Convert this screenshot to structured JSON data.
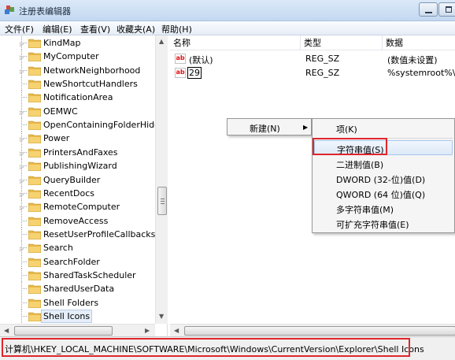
{
  "window": {
    "title": "注册表编辑器"
  },
  "menu": [
    "文件(F)",
    "编辑(E)",
    "查看(V)",
    "收藏夹(A)",
    "帮助(H)"
  ],
  "tree": {
    "items": [
      {
        "label": "KindMap",
        "expandable": true
      },
      {
        "label": "MyComputer",
        "expandable": true
      },
      {
        "label": "NetworkNeighborhood",
        "expandable": true
      },
      {
        "label": "NewShortcutHandlers",
        "expandable": false
      },
      {
        "label": "NotificationArea",
        "expandable": false
      },
      {
        "label": "OEMWC",
        "expandable": true
      },
      {
        "label": "OpenContainingFolderHidde",
        "expandable": false
      },
      {
        "label": "Power",
        "expandable": true
      },
      {
        "label": "PrintersAndFaxes",
        "expandable": true
      },
      {
        "label": "PublishingWizard",
        "expandable": true
      },
      {
        "label": "QueryBuilder",
        "expandable": true
      },
      {
        "label": "RecentDocs",
        "expandable": true
      },
      {
        "label": "RemoteComputer",
        "expandable": true
      },
      {
        "label": "RemoveAccess",
        "expandable": false
      },
      {
        "label": "ResetUserProfileCallbacks",
        "expandable": false
      },
      {
        "label": "Search",
        "expandable": true
      },
      {
        "label": "SearchFolder",
        "expandable": false
      },
      {
        "label": "SharedTaskScheduler",
        "expandable": false
      },
      {
        "label": "SharedUserData",
        "expandable": false
      },
      {
        "label": "Shell Folders",
        "expandable": false
      },
      {
        "label": "Shell Icons",
        "expandable": false,
        "selected": true
      }
    ]
  },
  "list": {
    "columns": [
      "名称",
      "类型",
      "数据"
    ],
    "rows": [
      {
        "name": "(默认)",
        "type": "REG_SZ",
        "data": "(数值未设置)"
      },
      {
        "name": "29",
        "type": "REG_SZ",
        "data": "%systemroot%\\S"
      }
    ]
  },
  "context_menu": {
    "new_label": "新建(N)"
  },
  "submenu": {
    "items": [
      "项(K)",
      "字符串值(S)",
      "二进制值(B)",
      "DWORD (32-位)值(D)",
      "QWORD (64 位)值(Q)",
      "多字符串值(M)",
      "可扩充字符串值(E)"
    ]
  },
  "status": {
    "path": "计算机\\HKEY_LOCAL_MACHINE\\SOFTWARE\\Microsoft\\Windows\\CurrentVersion\\Explorer\\Shell Icons"
  },
  "colors": {
    "highlight_border": "#e0262b",
    "folder": "#e8b949"
  }
}
